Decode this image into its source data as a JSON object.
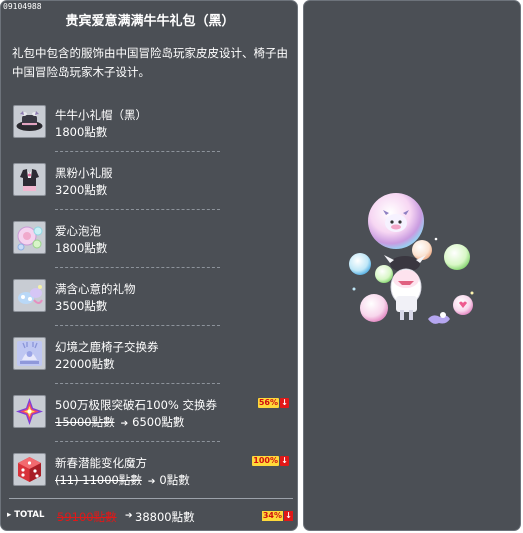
{
  "header": {
    "item_code": "09104988",
    "title": "贵宾爱意满满牛牛礼包（黑）"
  },
  "description": "礼包中包含的服饰由中国冒险岛玩家皮皮设计、椅子由中国冒险岛玩家木子设计。",
  "items": [
    {
      "icon": "cow-hat-icon",
      "name": "牛牛小礼帽（黑）",
      "price": "1800點數"
    },
    {
      "icon": "outfit-icon",
      "name": "黑粉小礼服",
      "price": "3200點數"
    },
    {
      "icon": "bubble-icon",
      "name": "爱心泡泡",
      "price": "1800點數"
    },
    {
      "icon": "gift-icon",
      "name": "满含心意的礼物",
      "price": "3500點數"
    },
    {
      "icon": "deer-chair-icon",
      "name": "幻境之鹿椅子交换券",
      "price": "22000點數"
    },
    {
      "icon": "crystal-icon",
      "name": "500万极限突破石100% 交换券",
      "old_price": "15000點數",
      "new_price": "6500點數",
      "badge": "56%"
    },
    {
      "icon": "dice-cube-icon",
      "name": "新春潜能变化魔方",
      "old_price": "(11) 11000點數",
      "new_price": "0點數",
      "badge": "100%"
    }
  ],
  "total": {
    "label": "TOTAL",
    "old_price": "59100點數",
    "new_price": "38800點數",
    "badge": "34%"
  },
  "colors": {
    "panel_bg": "#4b4f55",
    "panel_border": "#6d737b",
    "badge_bg": "#ffd93a",
    "badge_text": "#d01010",
    "discount_red": "#e01818"
  }
}
